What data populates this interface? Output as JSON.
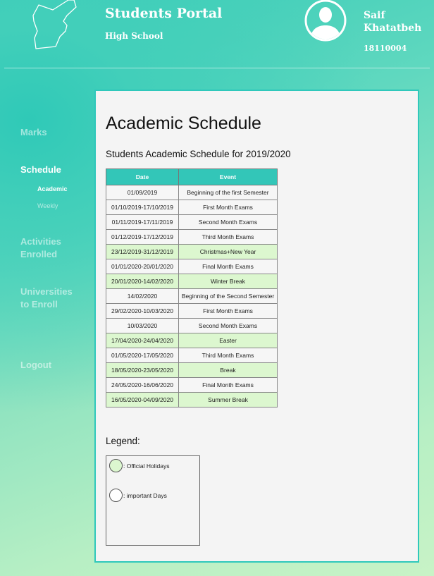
{
  "header": {
    "title": "Students Portal",
    "subtitle": "High School",
    "user_name": "Saif Khatatbeh",
    "user_id": "18110004",
    "logo_icon": "jordan-map-outline-icon",
    "avatar_icon": "user-avatar-icon"
  },
  "sidebar": {
    "items": [
      {
        "label": "Marks",
        "active": false
      },
      {
        "label": "Schedule",
        "active": true
      },
      {
        "label": "Activities Enrolled",
        "active": false
      },
      {
        "label": "Universities to Enroll",
        "active": false
      },
      {
        "label": "Logout",
        "active": false
      }
    ],
    "schedule_sub": [
      {
        "label": "Academic",
        "active": true
      },
      {
        "label": "Weekly",
        "active": false
      }
    ]
  },
  "main": {
    "title": "Academic Schedule",
    "subtitle": "Students Academic Schedule for 2019/2020",
    "table": {
      "headers": [
        "Date",
        "Event"
      ],
      "rows": [
        {
          "date": "01/09/2019",
          "event": "Beginning of the first Semester",
          "holiday": false
        },
        {
          "date": "01/10/2019-17/10/2019",
          "event": "First Month Exams",
          "holiday": false
        },
        {
          "date": "01/11/2019-17/11/2019",
          "event": "Second Month Exams",
          "holiday": false
        },
        {
          "date": "01/12/2019-17/12/2019",
          "event": "Third Month Exams",
          "holiday": false
        },
        {
          "date": "23/12/2019-31/12/2019",
          "event": "Christmas+New Year",
          "holiday": true
        },
        {
          "date": "01/01/2020-20/01/2020",
          "event": "Final Month Exams",
          "holiday": false
        },
        {
          "date": "20/01/2020-14/02/2020",
          "event": "Winter Break",
          "holiday": true
        },
        {
          "date": "14/02/2020",
          "event": "Beginning of the Second Semester",
          "holiday": false
        },
        {
          "date": "29/02/2020-10/03/2020",
          "event": "First Month Exams",
          "holiday": false
        },
        {
          "date": "10/03/2020",
          "event": "Second Month Exams",
          "holiday": false
        },
        {
          "date": "17/04/2020-24/04/2020",
          "event": "Easter",
          "holiday": true
        },
        {
          "date": "01/05/2020-17/05/2020",
          "event": "Third Month Exams",
          "holiday": false
        },
        {
          "date": "18/05/2020-23/05/2020",
          "event": "Break",
          "holiday": true
        },
        {
          "date": "24/05/2020-16/06/2020",
          "event": "Final Month Exams",
          "holiday": false
        },
        {
          "date": "16/05/2020-04/09/2020",
          "event": "Summer Break",
          "holiday": true
        }
      ]
    },
    "legend": {
      "title": "Legend:",
      "items": [
        {
          "label": ": Official Holidays",
          "color": "#dcf7cf"
        },
        {
          "label": ": important Days",
          "color": "#ffffff"
        }
      ]
    }
  },
  "colors": {
    "accent": "#2fc8bb",
    "header_cell": "#33c6b8",
    "holiday_row": "#dcf7cf",
    "panel": "#f4f4f4"
  }
}
